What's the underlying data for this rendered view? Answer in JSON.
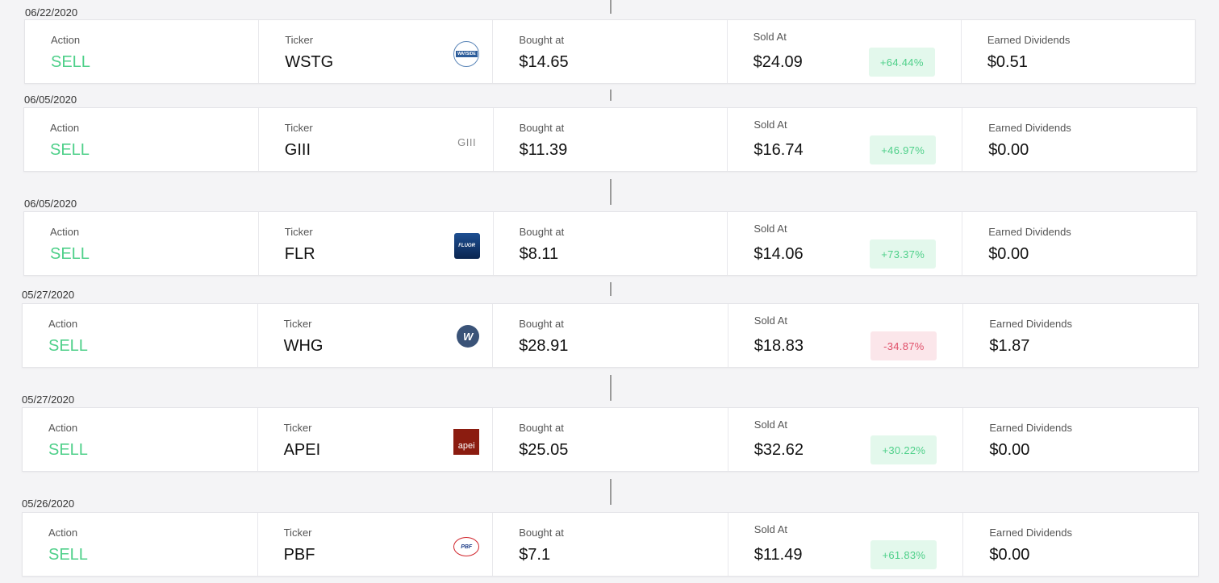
{
  "labels": {
    "action": "Action",
    "ticker": "Ticker",
    "bought": "Bought at",
    "sold": "Sold At",
    "dividends": "Earned Dividends"
  },
  "trades": [
    {
      "date": "06/22/2020",
      "action": "SELL",
      "ticker": "WSTG",
      "logo_icon": "wayside-logo-icon",
      "logo_text": "WAYSIDE",
      "bought": "$14.65",
      "sold": "$24.09",
      "change": "+64.44%",
      "change_dir": "up",
      "dividends": "$0.51"
    },
    {
      "date": "06/05/2020",
      "action": "SELL",
      "ticker": "GIII",
      "logo_icon": "giii-logo-icon",
      "logo_text": "GIII",
      "bought": "$11.39",
      "sold": "$16.74",
      "change": "+46.97%",
      "change_dir": "up",
      "dividends": "$0.00"
    },
    {
      "date": "06/05/2020",
      "action": "SELL",
      "ticker": "FLR",
      "logo_icon": "fluor-logo-icon",
      "logo_text": "FLUOR",
      "bought": "$8.11",
      "sold": "$14.06",
      "change": "+73.37%",
      "change_dir": "up",
      "dividends": "$0.00"
    },
    {
      "date": "05/27/2020",
      "action": "SELL",
      "ticker": "WHG",
      "logo_icon": "whg-logo-icon",
      "logo_text": "W",
      "bought": "$28.91",
      "sold": "$18.83",
      "change": "-34.87%",
      "change_dir": "down",
      "dividends": "$1.87"
    },
    {
      "date": "05/27/2020",
      "action": "SELL",
      "ticker": "APEI",
      "logo_icon": "apei-logo-icon",
      "logo_text": "apei",
      "bought": "$25.05",
      "sold": "$32.62",
      "change": "+30.22%",
      "change_dir": "up",
      "dividends": "$0.00"
    },
    {
      "date": "05/26/2020",
      "action": "SELL",
      "ticker": "PBF",
      "logo_icon": "pbf-logo-icon",
      "logo_text": "PBF",
      "bought": "$7.1",
      "sold": "$11.49",
      "change": "+61.83%",
      "change_dir": "up",
      "dividends": "$0.00"
    }
  ],
  "colors": {
    "positive": "#4fd08a",
    "negative": "#e0506a",
    "positive_bg": "#e3f8ec",
    "negative_bg": "#fbe6ea"
  }
}
